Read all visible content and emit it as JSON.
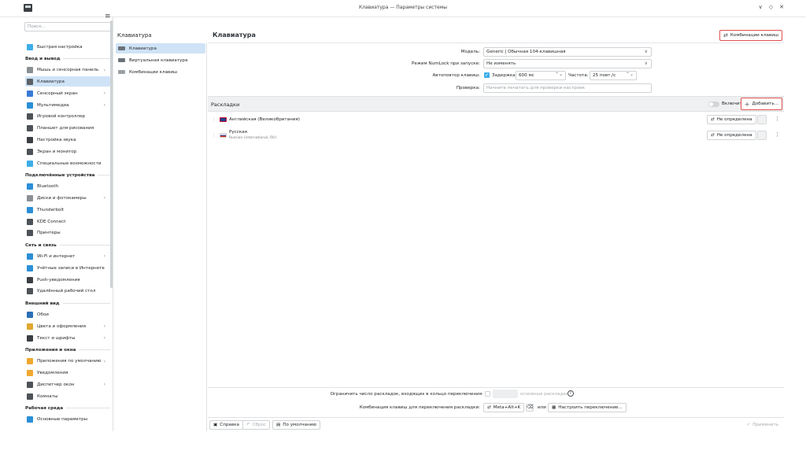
{
  "window": {
    "title": "Клавиатура — Параметры системы",
    "controls": [
      "∨",
      "◇",
      "✕"
    ]
  },
  "sidebar": {
    "search_placeholder": "Поиск...",
    "items": [
      {
        "type": "item",
        "label": "Быстрая настройка",
        "icon": "quick-settings-icon",
        "color": "#3daee9"
      },
      {
        "type": "section",
        "label": "Ввод и вывод"
      },
      {
        "type": "item",
        "label": "Мышь и сенсорная панель",
        "icon": "mouse-icon",
        "color": "#8a8f94",
        "arrow": true
      },
      {
        "type": "item",
        "label": "Клавиатура",
        "icon": "keyboard-icon",
        "color": "#5c6166",
        "selected": true
      },
      {
        "type": "item",
        "label": "Сенсорный экран",
        "icon": "touchscreen-icon",
        "color": "#3a7bd5",
        "arrow": true
      },
      {
        "type": "item",
        "label": "Мультимедиа",
        "icon": "multimedia-icon",
        "color": "#2b8fd6",
        "arrow": true
      },
      {
        "type": "item",
        "label": "Игровой контроллер",
        "icon": "gamepad-icon",
        "color": "#4d5258"
      },
      {
        "type": "item",
        "label": "Планшет для рисования",
        "icon": "tablet-icon",
        "color": "#4d5258"
      },
      {
        "type": "item",
        "label": "Настройка звука",
        "icon": "speaker-icon",
        "color": "#3b3e42"
      },
      {
        "type": "item",
        "label": "Экран и монитор",
        "icon": "monitor-icon",
        "color": "#4d5258"
      },
      {
        "type": "item",
        "label": "Специальные возможности",
        "icon": "accessibility-icon",
        "color": "#3daee9"
      },
      {
        "type": "section",
        "label": "Подключённые устройства"
      },
      {
        "type": "item",
        "label": "Bluetooth",
        "icon": "bluetooth-icon",
        "color": "#2b8fd6"
      },
      {
        "type": "item",
        "label": "Диски и фотокамеры",
        "icon": "disk-icon",
        "color": "#8a8f94",
        "arrow": true
      },
      {
        "type": "item",
        "label": "Thunderbolt",
        "icon": "thunderbolt-icon",
        "color": "#2b8fd6"
      },
      {
        "type": "item",
        "label": "KDE Connect",
        "icon": "phone-icon",
        "color": "#4d5258"
      },
      {
        "type": "item",
        "label": "Принтеры",
        "icon": "printer-icon",
        "color": "#4d5258"
      },
      {
        "type": "section",
        "label": "Сеть и связь"
      },
      {
        "type": "item",
        "label": "Wi-Fi и интернет",
        "icon": "wifi-icon",
        "color": "#2b8fd6",
        "arrow": true
      },
      {
        "type": "item",
        "label": "Учётные записи в Интернете",
        "icon": "online-accounts-icon",
        "color": "#2b8fd6"
      },
      {
        "type": "item",
        "label": "Push-уведомления",
        "icon": "push-icon",
        "color": "#3b3e42"
      },
      {
        "type": "item",
        "label": "Удалённый рабочий стол",
        "icon": "remote-desktop-icon",
        "color": "#4d5258"
      },
      {
        "type": "section",
        "label": "Внешний вид"
      },
      {
        "type": "item",
        "label": "Обои",
        "icon": "wallpaper-icon",
        "color": "#2b6fb5"
      },
      {
        "type": "item",
        "label": "Цвета и оформления",
        "icon": "colors-icon",
        "color": "#e0a82e",
        "arrow": true
      },
      {
        "type": "item",
        "label": "Текст и шрифты",
        "icon": "fonts-icon",
        "color": "#3b3e42",
        "arrow": true
      },
      {
        "type": "section",
        "label": "Приложения и окна"
      },
      {
        "type": "item",
        "label": "Приложения по умолчанию",
        "icon": "star-icon",
        "color": "#f0a830",
        "arrow": true
      },
      {
        "type": "item",
        "label": "Уведомления",
        "icon": "bell-icon",
        "color": "#f0a830"
      },
      {
        "type": "item",
        "label": "Диспетчер окон",
        "icon": "window-manager-icon",
        "color": "#4d5258",
        "arrow": true
      },
      {
        "type": "item",
        "label": "Комнаты",
        "icon": "activities-icon",
        "color": "#4d5258"
      },
      {
        "type": "section",
        "label": "Рабочая среда"
      },
      {
        "type": "item",
        "label": "Основные параметры",
        "icon": "general-settings-icon",
        "color": "#2b8fd6"
      }
    ]
  },
  "subnav": {
    "title": "Клавиатура",
    "items": [
      {
        "label": "Клавиатура",
        "selected": true
      },
      {
        "label": "Виртуальная клавиатура"
      },
      {
        "label": "Комбинации клавиш"
      }
    ]
  },
  "main": {
    "title": "Клавиатура",
    "shortcuts_button": "Комбинации клавиш",
    "form": {
      "model_label": "Модель:",
      "model_value": "Generic | Обычная 104-клавишная",
      "numlock_label": "Режим NumLock при запуске:",
      "numlock_value": "Не изменять",
      "repeat_label": "Автоповтор клавиш:",
      "delay_label": "Задержка:",
      "delay_value": "600 мс",
      "rate_label": "Частота:",
      "rate_value": "25 повт./с",
      "test_label": "Проверка:",
      "test_placeholder": "Начните печатать для проверки настроек"
    },
    "layouts": {
      "title": "Раскладки",
      "enable_label": "Включить",
      "add_label": "Добавить...",
      "rows": [
        {
          "name": "Английская (Великобритания)",
          "sub": "",
          "button": "Не определена"
        },
        {
          "name": "Русская",
          "sub": "Russian (international, RU)",
          "button": "Не определена"
        }
      ]
    },
    "bottom": {
      "limit_label": "Ограничить число раскладок, входящих в кольцо переключения:",
      "limit_suffix": "основные раскладки",
      "switch_label": "Комбинация клавиш для переключения раскладки:",
      "switch_value": "Meta+Alt+K",
      "or_label": "или",
      "configure_label": "Настроить переключение..."
    },
    "footer": {
      "help": "Справка",
      "reset": "Сброс",
      "defaults": "По умолчанию",
      "apply": "Применить"
    }
  }
}
